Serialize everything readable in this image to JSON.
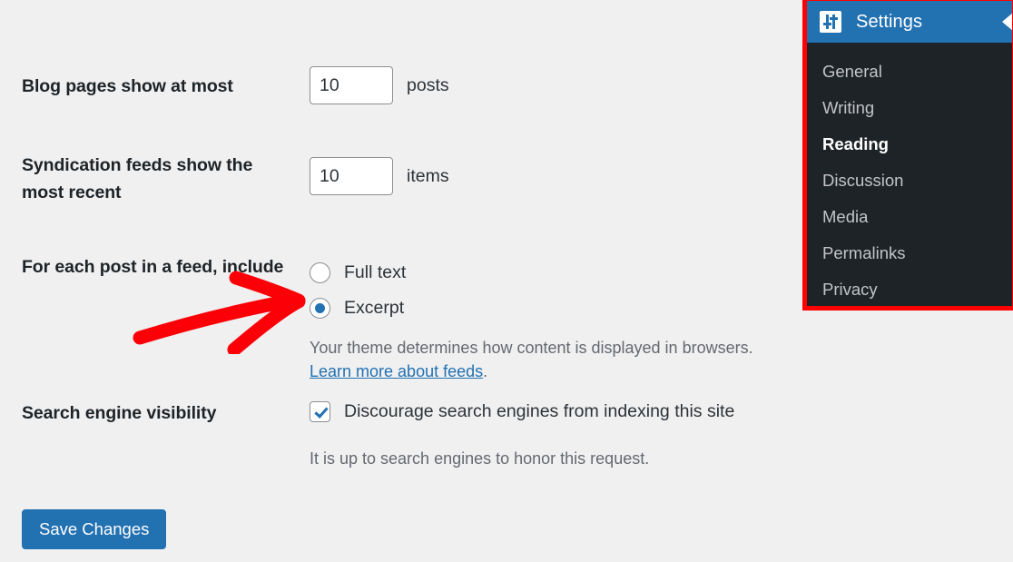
{
  "page": {
    "background_color": "#f0f0f1",
    "accent_color": "#2271b1",
    "annotation_color": "#ff0000"
  },
  "form": {
    "rows": [
      {
        "label": "Blog pages show at most",
        "input_value": "10",
        "unit": "posts"
      },
      {
        "label": "Syndication feeds show the most recent",
        "input_value": "10",
        "unit": "items"
      }
    ],
    "feed_include": {
      "label": "For each post in a feed, include",
      "options": [
        {
          "label": "Full text",
          "selected": false
        },
        {
          "label": "Excerpt",
          "selected": true
        }
      ],
      "help_text": "Your theme determines how content is displayed in browsers.",
      "help_link": "Learn more about feeds",
      "help_suffix": "."
    },
    "search_visibility": {
      "label": "Search engine visibility",
      "checkbox_label": "Discourage search engines from indexing this site",
      "checked": true,
      "help_text": "It is up to search engines to honor this request."
    },
    "save_label": "Save Changes"
  },
  "sidebar": {
    "title": "Settings",
    "icon": "settings-sliders-icon",
    "collapse_icon": "triangle-right-icon",
    "items": [
      {
        "label": "General",
        "current": false
      },
      {
        "label": "Writing",
        "current": false
      },
      {
        "label": "Reading",
        "current": true
      },
      {
        "label": "Discussion",
        "current": false
      },
      {
        "label": "Media",
        "current": false
      },
      {
        "label": "Permalinks",
        "current": false
      },
      {
        "label": "Privacy",
        "current": false
      }
    ]
  },
  "annotation": {
    "type": "red-arrow",
    "points_to": "Excerpt"
  }
}
